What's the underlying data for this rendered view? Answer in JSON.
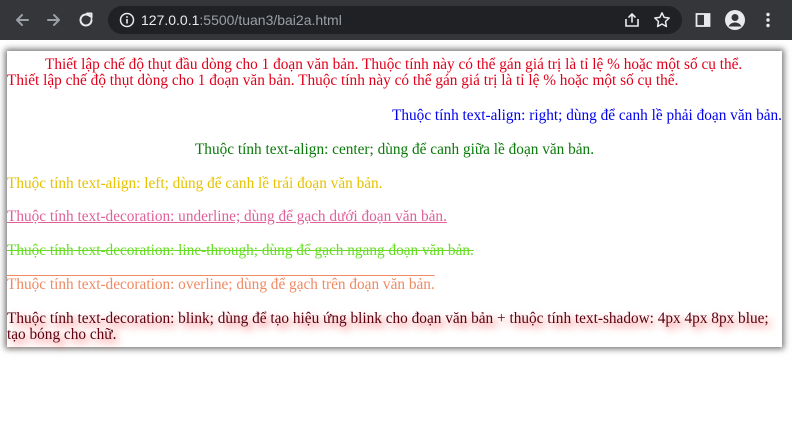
{
  "browser": {
    "url_host": "127.0.0.1",
    "url_rest": ":5500/tuan3/bai2a.html",
    "icons": [
      "back-icon",
      "forward-icon",
      "reload-icon",
      "info-icon",
      "share-icon",
      "bookmark-star-icon",
      "side-panel-icon",
      "profile-icon",
      "menu-dots-icon"
    ]
  },
  "page": {
    "p1": "Thiết lập chế độ thụt đầu dòng cho 1 đoạn văn bản. Thuộc tính này có thể gán giá trị là tỉ lệ % hoặc một số cụ thể.",
    "p2": "Thiết lập chế độ thụt dòng cho 1 đoạn văn bản. Thuộc tính này có thể gán giá trị là tỉ lệ % hoặc một số cụ thể.",
    "p3": "Thuộc tính text-align: right; dùng để canh lề phải đoạn văn bản.",
    "p4": "Thuộc tính text-align: center; dùng để canh giữa lề đoạn văn bản.",
    "p5": "Thuộc tính text-align: left; dùng để canh lề trái đoạn văn bản.",
    "p6": "Thuộc tính text-decoration: underline; dùng để gạch dưới đoạn văn bản.",
    "p7": "Thuộc tính text-decoration: line-through; dùng để gạch ngang đoạn văn bản.",
    "p8": "Thuộc tính text-decoration: overline; dùng để gạch trên đoạn văn bản.",
    "p9": "Thuộc tính text-decoration: blink; dùng để tạo hiệu ứng blink cho đoạn văn bản + thuộc tính text-shadow: 4px 4px 8px blue; tạo bóng cho chữ."
  },
  "colors": {
    "red": "#e0001b",
    "blue": "#0000ee",
    "green": "#0a7a0a",
    "gold": "#e6c200",
    "pink": "#e0609a",
    "lime": "#66dd22",
    "salmon": "#f08a63",
    "maroon": "#5a0010"
  }
}
